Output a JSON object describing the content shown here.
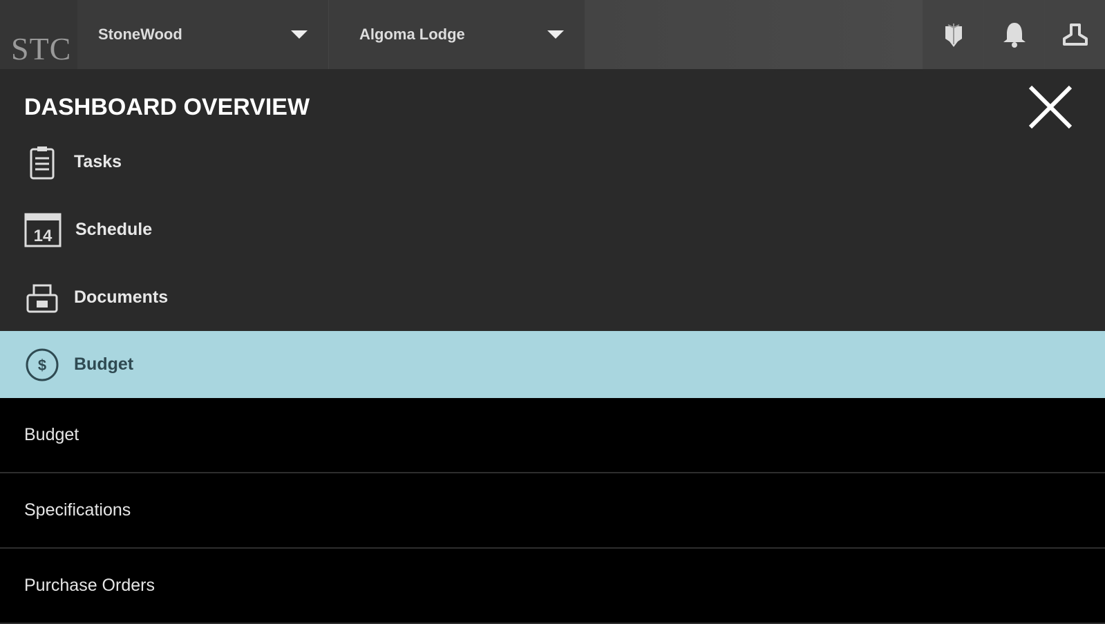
{
  "header": {
    "logo": "STC",
    "company": "StoneWood",
    "project": "Algoma Lodge"
  },
  "menu": {
    "title": "DASHBOARD OVERVIEW",
    "items": [
      {
        "label": "Tasks",
        "icon": "clipboard-icon"
      },
      {
        "label": "Schedule",
        "icon": "calendar-icon",
        "icon_text": "14"
      },
      {
        "label": "Documents",
        "icon": "documents-icon"
      },
      {
        "label": "Budget",
        "icon": "budget-icon",
        "active": true
      }
    ],
    "sub_items": [
      "Budget",
      "Specifications",
      "Purchase Orders"
    ]
  },
  "colors": {
    "active": "#a9d6df",
    "panel": "#2a2a2a",
    "header": "#3b3b3b"
  }
}
